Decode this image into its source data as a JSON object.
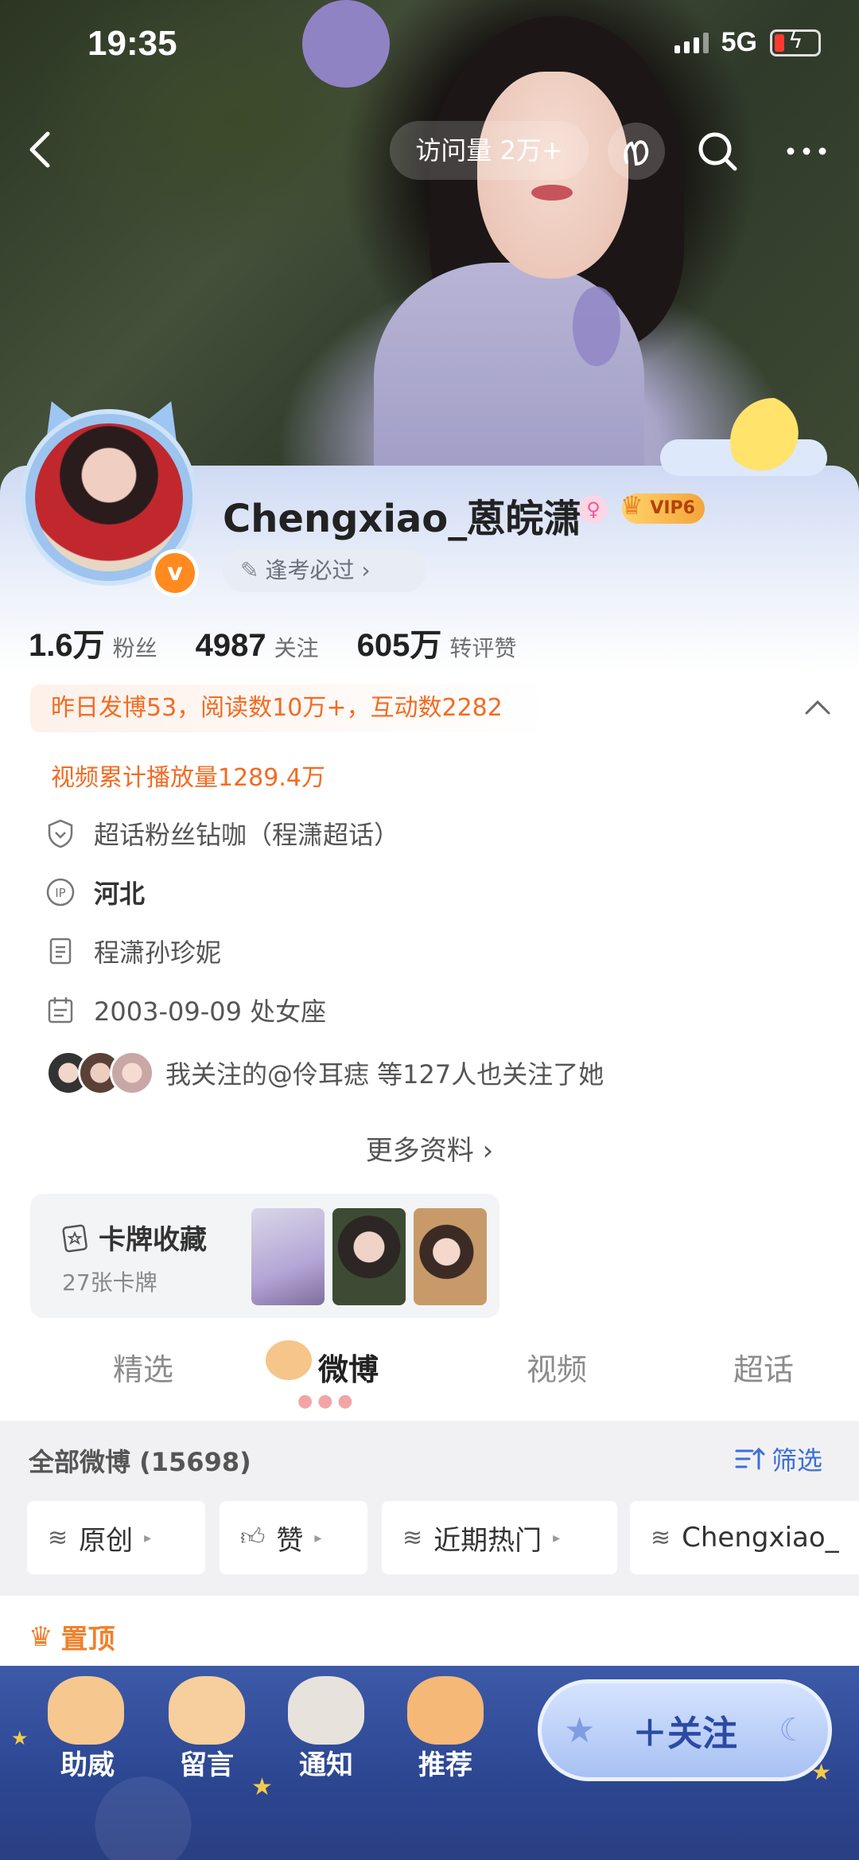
{
  "status_bar": {
    "time": "19:35",
    "network": "5G"
  },
  "nav": {
    "visits": "访问量 2万+"
  },
  "profile": {
    "name": "Chengxiao_蒽皖潇",
    "vip": "VIP6",
    "tag": "逢考必过 ›",
    "stats": [
      {
        "value": "1.6万",
        "label": "粉丝"
      },
      {
        "value": "4987",
        "label": "关注"
      },
      {
        "value": "605万",
        "label": "转评赞"
      }
    ],
    "yesterday": "昨日发博53，阅读数10万+，互动数2282",
    "video_plays": "视频累计播放量1289.4万",
    "info": {
      "supertopic": "超话粉丝钻咖（程潇超话）",
      "ip": "河北",
      "bio": "程潇孙珍妮",
      "birthday": "2003-09-09 处女座"
    },
    "mutual": "我关注的@伶耳痣 等127人也关注了她",
    "more_info": "更多资料 ›"
  },
  "card_collection": {
    "title": "卡牌收藏",
    "count": "27张卡牌"
  },
  "tabs": [
    "精选",
    "微博",
    "视频",
    "超话"
  ],
  "feed": {
    "all_label": "全部微博 (15698)",
    "filter_label": "筛选",
    "chips": [
      "原创",
      "赞",
      "近期热门",
      "Chengxiao_"
    ],
    "pinned": "置顶"
  },
  "bottom": {
    "actions": [
      "助威",
      "留言",
      "通知",
      "推荐"
    ],
    "follow": "＋关注"
  },
  "colors": {
    "accent_orange": "#f36b22",
    "follow_blue": "#2b4aa3",
    "filter_blue": "#3d6fd6"
  }
}
